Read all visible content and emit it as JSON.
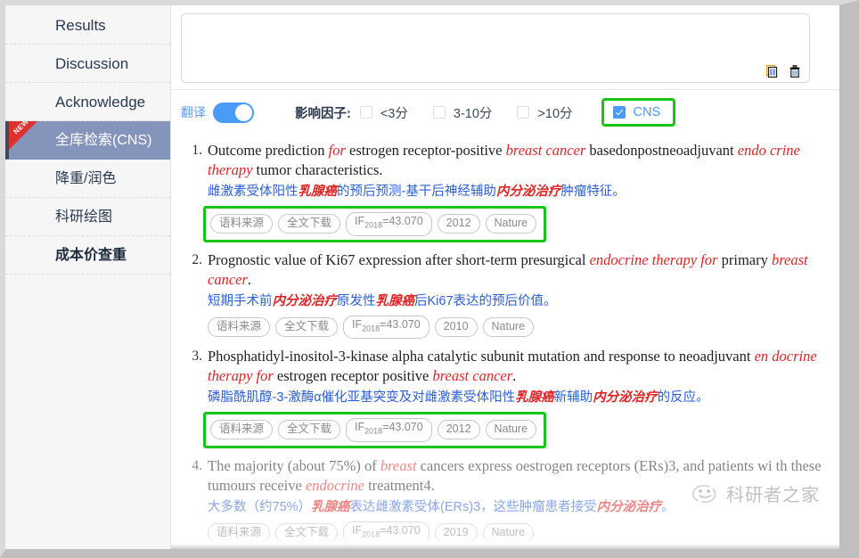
{
  "sidebar": {
    "items": [
      {
        "label": "Results",
        "active": false,
        "badge": null,
        "bold": false,
        "cn": false
      },
      {
        "label": "Discussion",
        "active": false,
        "badge": null,
        "bold": false,
        "cn": false
      },
      {
        "label": "Acknowledge",
        "active": false,
        "badge": null,
        "bold": false,
        "cn": false
      },
      {
        "label": "全库检索(CNS)",
        "active": true,
        "badge": "NEW",
        "bold": false,
        "cn": true
      },
      {
        "label": "降重/润色",
        "active": false,
        "badge": null,
        "bold": false,
        "cn": true
      },
      {
        "label": "科研绘图",
        "active": false,
        "badge": null,
        "bold": false,
        "cn": true
      },
      {
        "label": "成本价查重",
        "active": false,
        "badge": null,
        "bold": true,
        "cn": true
      }
    ]
  },
  "input_card": {
    "value": "",
    "placeholder": "",
    "actions": [
      {
        "name": "copy-icon",
        "title": "复制"
      },
      {
        "name": "trash-icon",
        "title": "清空"
      }
    ]
  },
  "toolbar": {
    "translate_label": "翻译",
    "translate_on": true,
    "impact_factor_label": "影响因子:",
    "filters": [
      {
        "label": "<3分",
        "checked": false,
        "highlighted": false
      },
      {
        "label": "3-10分",
        "checked": false,
        "highlighted": false
      },
      {
        "label": ">10分",
        "checked": false,
        "highlighted": false
      },
      {
        "label": "CNS",
        "checked": true,
        "highlighted": true
      }
    ]
  },
  "results": [
    {
      "number": "1.",
      "title_parts": [
        {
          "t": "Outcome prediction ",
          "hl": false
        },
        {
          "t": "for",
          "hl": true
        },
        {
          "t": " estrogen receptor-positive ",
          "hl": false
        },
        {
          "t": "breast cancer",
          "hl": true
        },
        {
          "t": " basedonpostneoadjuvant ",
          "hl": false
        },
        {
          "t": "endo crine therapy",
          "hl": true
        },
        {
          "t": " tumor characteristics.",
          "hl": false
        }
      ],
      "translation_parts": [
        {
          "t": "雌激素受体阳性",
          "hl": false
        },
        {
          "t": "乳腺癌",
          "hl": true
        },
        {
          "t": "的预后预测-基干后神经辅助",
          "hl": false
        },
        {
          "t": "内分泌治疗",
          "hl": true
        },
        {
          "t": "肿瘤特征。",
          "hl": false
        }
      ],
      "tags": [
        "语料来源",
        "全文下载",
        "IF2018=43.070",
        "2012",
        "Nature"
      ],
      "if_year": "2018",
      "if_value": "=43.070",
      "tags_highlighted": true,
      "clipped": false
    },
    {
      "number": "2.",
      "title_parts": [
        {
          "t": "Prognostic value of Ki67 expression after short-term presurgical ",
          "hl": false
        },
        {
          "t": "endocrine therapy for",
          "hl": true
        },
        {
          "t": " primary ",
          "hl": false
        },
        {
          "t": "breast cancer",
          "hl": true
        },
        {
          "t": ".",
          "hl": false
        }
      ],
      "translation_parts": [
        {
          "t": "短期手术前",
          "hl": false
        },
        {
          "t": "内分泌治疗",
          "hl": true
        },
        {
          "t": "原发性",
          "hl": false
        },
        {
          "t": "乳腺癌",
          "hl": true
        },
        {
          "t": "后Ki67表达的预后价值。",
          "hl": false
        }
      ],
      "tags": [
        "语料来源",
        "全文下载",
        "IF2018=43.070",
        "2010",
        "Nature"
      ],
      "if_year": "2018",
      "if_value": "=43.070",
      "tags_highlighted": false,
      "clipped": false
    },
    {
      "number": "3.",
      "title_parts": [
        {
          "t": "Phosphatidyl-inositol-3-kinase alpha catalytic subunit mutation and response to neoadjuvant ",
          "hl": false
        },
        {
          "t": "en docrine therapy for",
          "hl": true
        },
        {
          "t": " estrogen receptor positive ",
          "hl": false
        },
        {
          "t": "breast cancer",
          "hl": true
        },
        {
          "t": ".",
          "hl": false
        }
      ],
      "translation_parts": [
        {
          "t": "磷脂酰肌醇-3-激酶α催化亚基突变及对雌激素受体阳性",
          "hl": false
        },
        {
          "t": "乳腺癌",
          "hl": true
        },
        {
          "t": "新辅助",
          "hl": false
        },
        {
          "t": "内分泌治疗",
          "hl": true
        },
        {
          "t": "的反应。",
          "hl": false
        }
      ],
      "tags": [
        "语料来源",
        "全文下载",
        "IF2018=43.070",
        "2012",
        "Nature"
      ],
      "if_year": "2018",
      "if_value": "=43.070",
      "tags_highlighted": true,
      "clipped": false
    },
    {
      "number": "4.",
      "title_parts": [
        {
          "t": "The majority (about 75%) of ",
          "hl": false
        },
        {
          "t": "breast",
          "hl": true
        },
        {
          "t": " cancers express oestrogen receptors (ERs)3, and patients wi th these tumours receive ",
          "hl": false
        },
        {
          "t": "endocrine",
          "hl": true
        },
        {
          "t": " treatment4.",
          "hl": false
        }
      ],
      "translation_parts": [
        {
          "t": "大多数（约75%）",
          "hl": false
        },
        {
          "t": "乳腺癌",
          "hl": true
        },
        {
          "t": "表达雌激素受体(ERs)3，这些肿瘤患者接受",
          "hl": false
        },
        {
          "t": "内分泌治疗",
          "hl": true
        },
        {
          "t": "。",
          "hl": false
        }
      ],
      "tags": [
        "语料来源",
        "全文下载",
        "IF2018=43.070",
        "2019",
        "Nature"
      ],
      "if_year": "2018",
      "if_value": "=43.070",
      "tags_highlighted": false,
      "clipped": true
    }
  ],
  "watermark": {
    "text": "科研者之家"
  },
  "colors": {
    "accent_blue": "#4a9bf7",
    "highlight_green": "#17c517",
    "keyword_red": "#e02424",
    "translation_blue": "#2b5fd6",
    "sidebar_active": "#8494bb",
    "ribbon_red": "#e03131"
  }
}
